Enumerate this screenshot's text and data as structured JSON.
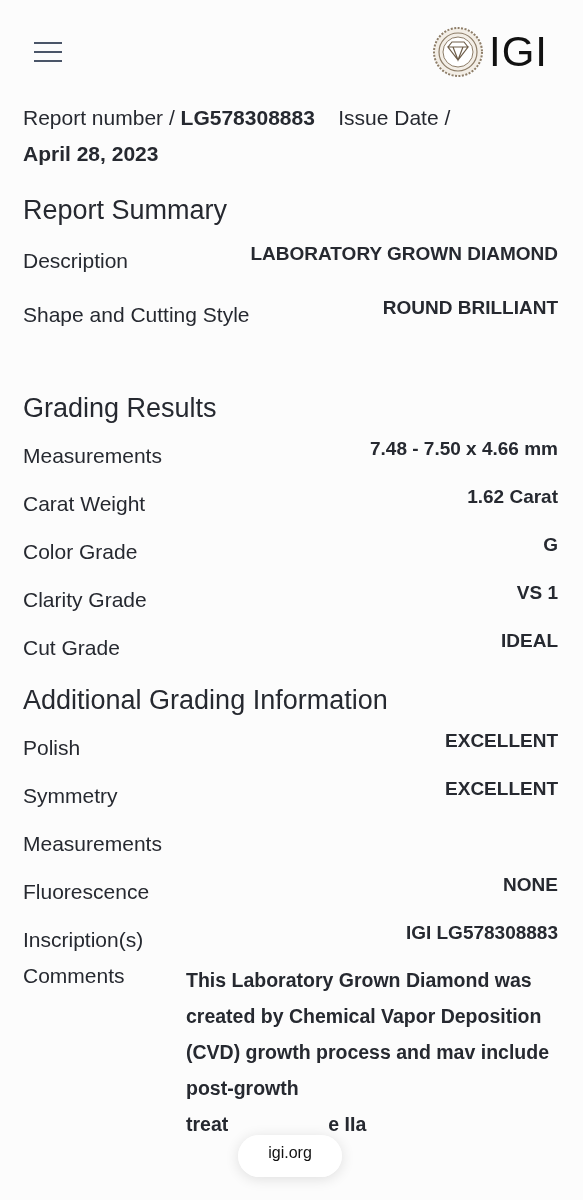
{
  "header": {
    "logo_text": "IGI"
  },
  "report": {
    "number_label": "Report number /",
    "number": "LG578308883",
    "date_label": "Issue Date /",
    "date": "April 28, 2023"
  },
  "sections": [
    {
      "title": "Report Summary",
      "kind": "summary",
      "rows": [
        {
          "label": "Description",
          "value": "LABORATORY GROWN DIAMOND"
        },
        {
          "label": "Shape and Cutting Style",
          "value": "ROUND BRILLIANT"
        }
      ]
    },
    {
      "title": "Grading Results",
      "kind": "grading",
      "rows": [
        {
          "label": "Measurements",
          "value": "7.48 - 7.50 x 4.66 mm"
        },
        {
          "label": "Carat Weight",
          "value": "1.62 Carat"
        },
        {
          "label": "Color Grade",
          "value": "G"
        },
        {
          "label": "Clarity Grade",
          "value": "VS 1"
        },
        {
          "label": "Cut Grade",
          "value": "IDEAL"
        }
      ]
    },
    {
      "title": "Additional Grading Information",
      "kind": "grading",
      "rows": [
        {
          "label": "Polish",
          "value": "EXCELLENT"
        },
        {
          "label": "Symmetry",
          "value": "EXCELLENT"
        },
        {
          "label": "Measurements"
        },
        {
          "label": "Fluorescence",
          "value": "NONE"
        },
        {
          "label": "Inscription(s)",
          "value": "IGI LG578308883"
        }
      ]
    }
  ],
  "comments": {
    "label": "Comments",
    "text": "This Laboratory Grown Diamond was created by Chemical Vapor Deposition (CVD) growth process and mav include post-growth",
    "tail_start": "treat",
    "tail_end": "e IIa"
  },
  "address_pill": {
    "url": "igi.org"
  }
}
